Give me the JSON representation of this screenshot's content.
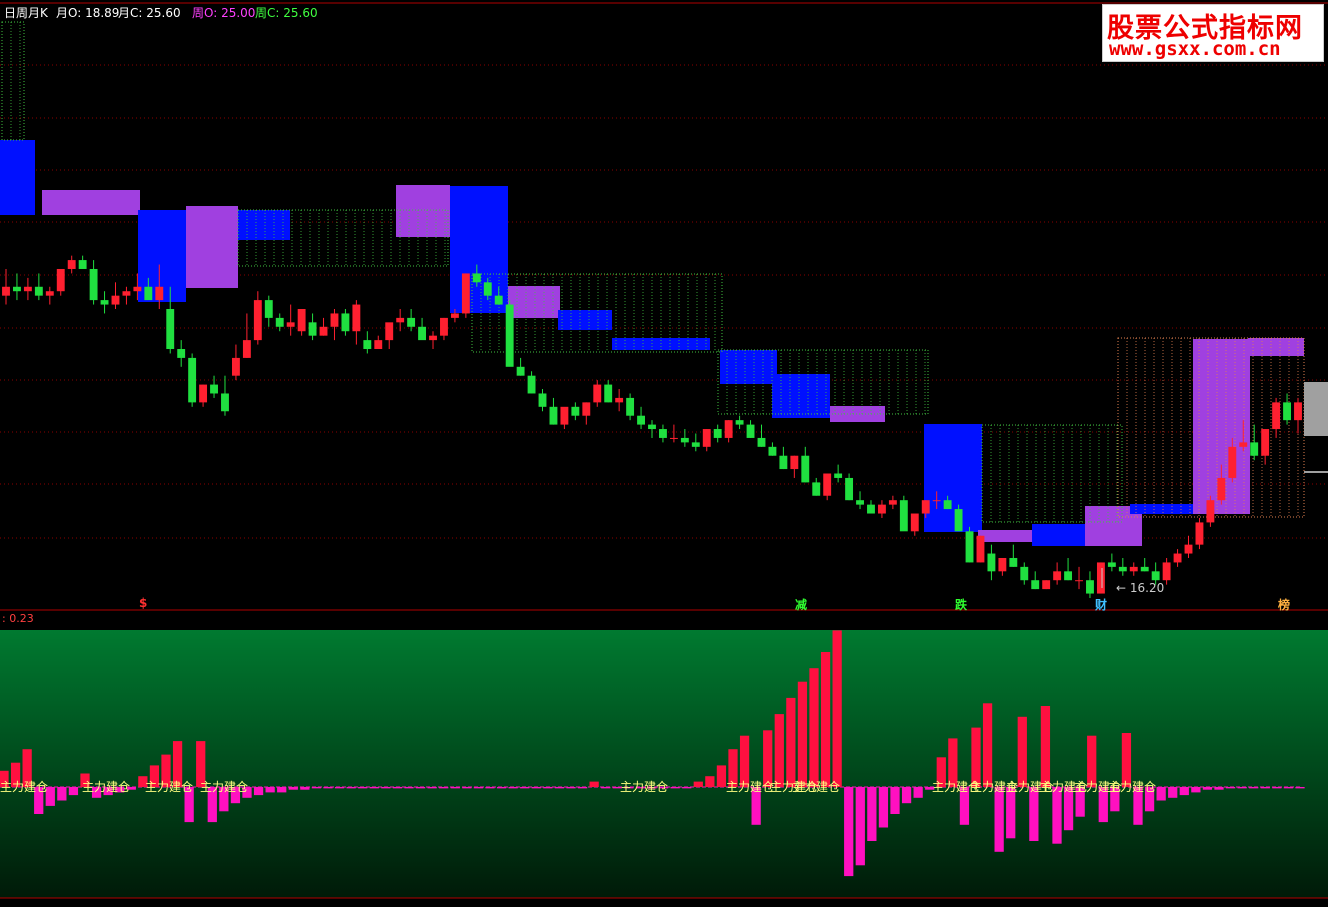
{
  "header": {
    "period_label": "日周月K",
    "month_open": "月O: 18.89",
    "month_close": "月C: 25.60",
    "week_open": "周O: 25.00",
    "week_close": "周C: 25.60"
  },
  "signals": [
    {
      "label": "$"
    },
    {
      "label": "减"
    },
    {
      "label": "跌"
    },
    {
      "label": "财"
    },
    {
      "label": "榜"
    }
  ],
  "low_marker": "16.20",
  "indicator": {
    "value_label": ": 0.23",
    "bar_label": "主力建仓"
  },
  "watermark": {
    "title": "股票公式指标网",
    "url": "www.gsxx.com.cn"
  },
  "colors": {
    "up": "#ff2030",
    "down": "#20e040",
    "box_blue": "#0010ff",
    "box_purple": "#a040e0",
    "bar_red": "#ff1040",
    "bar_magenta": "#ff10c0"
  },
  "chart_data": {
    "type": "candlestick",
    "y_axis": "price",
    "ylim": [
      16,
      29
    ],
    "low_label": 16.2,
    "candles": [
      [
        22.8,
        23.4,
        22.6,
        23.0
      ],
      [
        23.0,
        23.3,
        22.7,
        22.9
      ],
      [
        22.9,
        23.2,
        22.7,
        23.0
      ],
      [
        23.0,
        23.3,
        22.7,
        22.8
      ],
      [
        22.8,
        23.0,
        22.6,
        22.9
      ],
      [
        22.9,
        23.3,
        22.8,
        23.4
      ],
      [
        23.4,
        23.7,
        23.3,
        23.6
      ],
      [
        23.6,
        23.7,
        23.4,
        23.4
      ],
      [
        23.4,
        23.6,
        22.6,
        22.7
      ],
      [
        22.7,
        22.9,
        22.4,
        22.6
      ],
      [
        22.6,
        23.1,
        22.5,
        22.8
      ],
      [
        22.8,
        23.0,
        22.6,
        22.9
      ],
      [
        22.9,
        23.3,
        22.7,
        23.0
      ],
      [
        23.0,
        23.2,
        22.8,
        22.7
      ],
      [
        22.7,
        23.5,
        22.5,
        23.0
      ],
      [
        22.5,
        23.0,
        21.5,
        21.6
      ],
      [
        21.6,
        21.8,
        21.2,
        21.4
      ],
      [
        21.4,
        21.5,
        20.3,
        20.4
      ],
      [
        20.4,
        20.8,
        20.3,
        20.8
      ],
      [
        20.8,
        21.0,
        20.5,
        20.6
      ],
      [
        20.6,
        21.0,
        20.1,
        20.2
      ],
      [
        21.0,
        21.7,
        20.9,
        21.4
      ],
      [
        21.4,
        22.4,
        21.4,
        21.8
      ],
      [
        21.8,
        22.9,
        21.7,
        22.7
      ],
      [
        22.7,
        22.8,
        22.1,
        22.3
      ],
      [
        22.3,
        22.4,
        22.0,
        22.1
      ],
      [
        22.1,
        22.6,
        21.9,
        22.2
      ],
      [
        22.0,
        22.4,
        21.9,
        22.5
      ],
      [
        22.2,
        22.4,
        21.8,
        21.9
      ],
      [
        21.9,
        22.3,
        21.9,
        22.1
      ],
      [
        22.1,
        22.5,
        21.8,
        22.4
      ],
      [
        22.4,
        22.5,
        21.9,
        22.0
      ],
      [
        22.0,
        22.7,
        21.7,
        22.6
      ],
      [
        21.8,
        22.0,
        21.5,
        21.6
      ],
      [
        21.6,
        21.9,
        21.7,
        21.8
      ],
      [
        21.8,
        22.1,
        21.6,
        22.2
      ],
      [
        22.2,
        22.5,
        22.0,
        22.3
      ],
      [
        22.3,
        22.5,
        22.0,
        22.1
      ],
      [
        22.1,
        22.3,
        21.9,
        21.8
      ],
      [
        21.8,
        22.0,
        21.6,
        21.9
      ],
      [
        21.9,
        22.3,
        21.8,
        22.3
      ],
      [
        22.3,
        22.5,
        22.2,
        22.4
      ],
      [
        22.4,
        23.3,
        22.3,
        23.3
      ],
      [
        23.3,
        23.5,
        23.0,
        23.1
      ],
      [
        23.1,
        23.2,
        22.7,
        22.8
      ],
      [
        22.8,
        23.0,
        22.6,
        22.6
      ],
      [
        22.6,
        22.7,
        21.3,
        21.2
      ],
      [
        21.2,
        21.4,
        21.0,
        21.0
      ],
      [
        21.0,
        21.1,
        20.6,
        20.6
      ],
      [
        20.6,
        20.7,
        20.2,
        20.3
      ],
      [
        20.3,
        20.5,
        19.9,
        19.9
      ],
      [
        19.9,
        20.2,
        19.8,
        20.3
      ],
      [
        20.3,
        20.4,
        20.0,
        20.1
      ],
      [
        20.1,
        20.4,
        19.9,
        20.4
      ],
      [
        20.4,
        20.9,
        20.3,
        20.8
      ],
      [
        20.8,
        20.9,
        20.4,
        20.4
      ],
      [
        20.4,
        20.7,
        20.2,
        20.5
      ],
      [
        20.5,
        20.6,
        20.0,
        20.1
      ],
      [
        20.1,
        20.3,
        19.8,
        19.9
      ],
      [
        19.9,
        20.0,
        19.6,
        19.8
      ],
      [
        19.8,
        19.9,
        19.5,
        19.6
      ],
      [
        19.6,
        19.9,
        19.5,
        19.6
      ],
      [
        19.6,
        19.8,
        19.4,
        19.5
      ],
      [
        19.5,
        19.7,
        19.3,
        19.4
      ],
      [
        19.4,
        19.8,
        19.3,
        19.8
      ],
      [
        19.8,
        19.9,
        19.5,
        19.6
      ],
      [
        19.6,
        20.0,
        19.5,
        20.0
      ],
      [
        20.0,
        20.1,
        19.8,
        19.9
      ],
      [
        19.9,
        20.0,
        19.6,
        19.6
      ],
      [
        19.6,
        19.9,
        19.4,
        19.4
      ],
      [
        19.4,
        19.5,
        19.2,
        19.2
      ],
      [
        19.2,
        19.4,
        18.9,
        18.9
      ],
      [
        18.9,
        19.2,
        18.7,
        19.2
      ],
      [
        19.2,
        19.4,
        18.6,
        18.6
      ],
      [
        18.6,
        18.7,
        18.3,
        18.3
      ],
      [
        18.3,
        18.8,
        18.2,
        18.8
      ],
      [
        18.8,
        19.0,
        18.6,
        18.7
      ],
      [
        18.7,
        18.8,
        18.2,
        18.2
      ],
      [
        18.2,
        18.4,
        18.0,
        18.1
      ],
      [
        18.1,
        18.2,
        17.9,
        17.9
      ],
      [
        17.9,
        18.2,
        17.8,
        18.1
      ],
      [
        18.1,
        18.3,
        18.0,
        18.2
      ],
      [
        18.2,
        18.3,
        17.6,
        17.5
      ],
      [
        17.5,
        17.8,
        17.4,
        17.9
      ],
      [
        17.9,
        18.2,
        17.8,
        18.2
      ],
      [
        18.2,
        18.4,
        18.0,
        18.2
      ],
      [
        18.2,
        18.3,
        18.0,
        18.0
      ],
      [
        18.0,
        18.1,
        17.6,
        17.5
      ],
      [
        17.5,
        17.6,
        16.8,
        16.8
      ],
      [
        16.8,
        17.4,
        16.8,
        17.4
      ],
      [
        17.0,
        17.2,
        16.4,
        16.6
      ],
      [
        16.6,
        16.9,
        16.5,
        16.9
      ],
      [
        16.9,
        17.2,
        16.7,
        16.7
      ],
      [
        16.7,
        16.8,
        16.3,
        16.4
      ],
      [
        16.4,
        16.6,
        16.2,
        16.2
      ],
      [
        16.2,
        16.4,
        16.2,
        16.4
      ],
      [
        16.4,
        16.8,
        16.3,
        16.6
      ],
      [
        16.6,
        16.9,
        16.4,
        16.4
      ],
      [
        16.4,
        16.7,
        16.2,
        16.4
      ],
      [
        16.4,
        16.6,
        16.0,
        16.1
      ],
      [
        16.1,
        16.8,
        16.1,
        16.8
      ],
      [
        16.8,
        17.0,
        16.6,
        16.7
      ],
      [
        16.7,
        16.9,
        16.5,
        16.6
      ],
      [
        16.6,
        16.8,
        16.5,
        16.7
      ],
      [
        16.7,
        16.9,
        16.6,
        16.6
      ],
      [
        16.6,
        16.8,
        16.3,
        16.4
      ],
      [
        16.4,
        16.9,
        16.3,
        16.8
      ],
      [
        16.8,
        17.1,
        16.7,
        17.0
      ],
      [
        17.0,
        17.4,
        16.9,
        17.2
      ],
      [
        17.2,
        17.8,
        17.1,
        17.7
      ],
      [
        17.7,
        18.3,
        17.6,
        18.2
      ],
      [
        18.2,
        19.0,
        18.1,
        18.7
      ],
      [
        18.7,
        19.6,
        18.6,
        19.4
      ],
      [
        19.4,
        20.0,
        19.3,
        19.5
      ],
      [
        19.5,
        19.9,
        19.1,
        19.2
      ],
      [
        19.2,
        19.8,
        19.0,
        19.8
      ],
      [
        19.8,
        20.5,
        19.6,
        20.4
      ],
      [
        20.4,
        20.6,
        19.9,
        20.0
      ],
      [
        20.0,
        20.5,
        19.7,
        20.4
      ]
    ],
    "indicator_values": [
      0.6,
      0.9,
      1.4,
      -1.0,
      -0.7,
      -0.5,
      -0.3,
      0.5,
      -0.4,
      -0.3,
      -0.2,
      -0.1,
      0.4,
      0.8,
      1.2,
      1.7,
      -1.3,
      1.7,
      -1.3,
      -0.9,
      -0.6,
      -0.4,
      -0.3,
      -0.2,
      -0.2,
      -0.1,
      -0.1,
      -0.05,
      -0.05,
      -0.05,
      -0.05,
      -0.05,
      -0.05,
      -0.05,
      -0.05,
      -0.05,
      -0.05,
      -0.05,
      -0.05,
      -0.05,
      -0.05,
      -0.05,
      -0.05,
      -0.05,
      -0.05,
      -0.05,
      -0.05,
      -0.05,
      -0.05,
      -0.05,
      -0.05,
      0.2,
      -0.05,
      -0.05,
      -0.05,
      -0.05,
      -0.05,
      -0.05,
      -0.05,
      -0.05,
      0.2,
      0.4,
      0.8,
      1.4,
      1.9,
      -1.4,
      2.1,
      2.7,
      3.3,
      3.9,
      4.4,
      5.0,
      5.8,
      -3.3,
      -2.9,
      -2.0,
      -1.5,
      -1.0,
      -0.6,
      -0.4,
      -0.1,
      1.1,
      1.8,
      -1.4,
      2.2,
      3.1,
      -2.4,
      -1.9,
      2.6,
      -2.0,
      3.0,
      -2.1,
      -1.6,
      -1.1,
      1.9,
      -1.3,
      -0.9,
      2.0,
      -1.4,
      -0.9,
      -0.5,
      -0.4,
      -0.3,
      -0.2,
      -0.1,
      -0.1,
      -0.05,
      -0.05,
      -0.05,
      -0.05,
      -0.05,
      -0.05,
      -0.05
    ]
  }
}
